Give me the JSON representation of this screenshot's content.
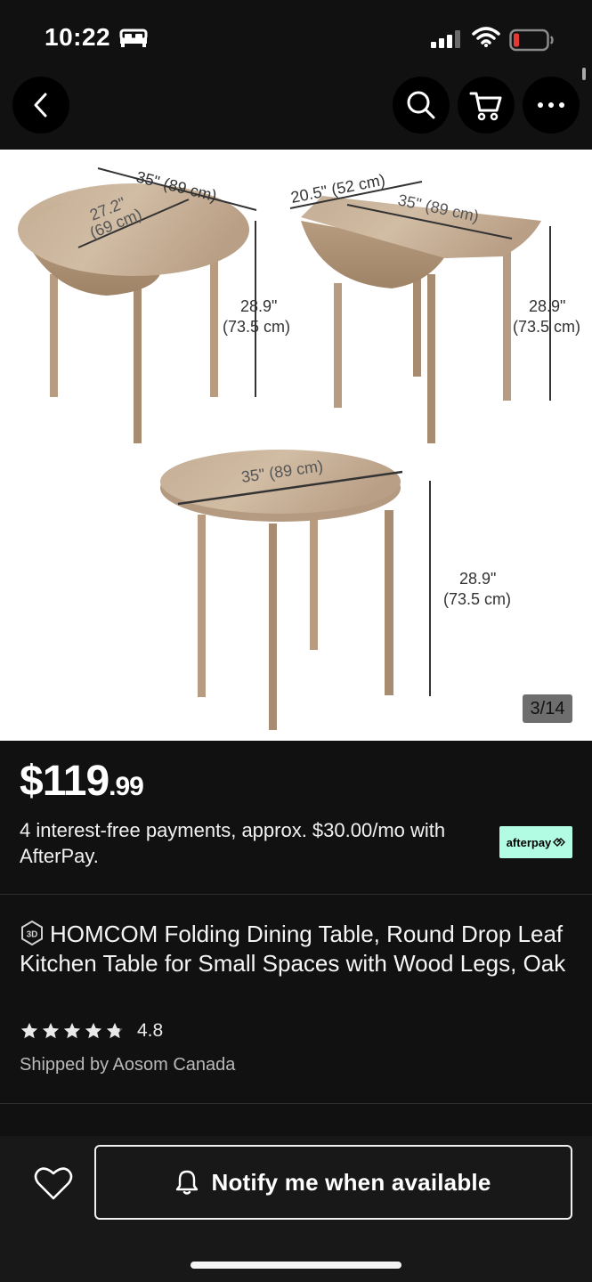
{
  "status_bar": {
    "time": "10:22",
    "icons": [
      "bed-icon",
      "cellular-signal-icon",
      "wifi-icon",
      "battery-low-icon"
    ],
    "battery_color": "#e53935"
  },
  "nav": {
    "back_icon": "chevron-left-icon",
    "actions": [
      "search-icon",
      "cart-icon",
      "more-horizontal-icon"
    ]
  },
  "gallery": {
    "counter": "3/14",
    "dimension_labels": {
      "left_width": "35\" (89 cm)",
      "left_depth_1": "27.2\"",
      "left_depth_2": "(69 cm)",
      "left_height_1": "28.9\"",
      "left_height_2": "(73.5 cm)",
      "right_depth": "20.5\" (52 cm)",
      "right_width": "35\" (89 cm)",
      "right_height_1": "28.9\"",
      "right_height_2": "(73.5 cm)",
      "bottom_width": "35\" (89 cm)",
      "bottom_height_1": "28.9\"",
      "bottom_height_2": "(73.5 cm)"
    },
    "wood_color": "#c9b29a"
  },
  "price": {
    "dollars": "$119",
    "cents": ".99",
    "installments": "4 interest-free payments, approx. $30.00/mo with AfterPay.",
    "afterpay_label": "afterpay",
    "afterpay_color": "#b2fce4"
  },
  "product": {
    "badge": "3D",
    "title": "HOMCOM Folding Dining Table, Round Drop Leaf Kitchen Table for Small Spaces with Wood Legs, Oak",
    "rating": 4.8,
    "rating_text": "4.8",
    "shipped_by": "Shipped by Aosom Canada"
  },
  "footer": {
    "wishlist_icon": "heart-outline-icon",
    "notify_icon": "bell-icon",
    "notify_label": "Notify me when available"
  }
}
